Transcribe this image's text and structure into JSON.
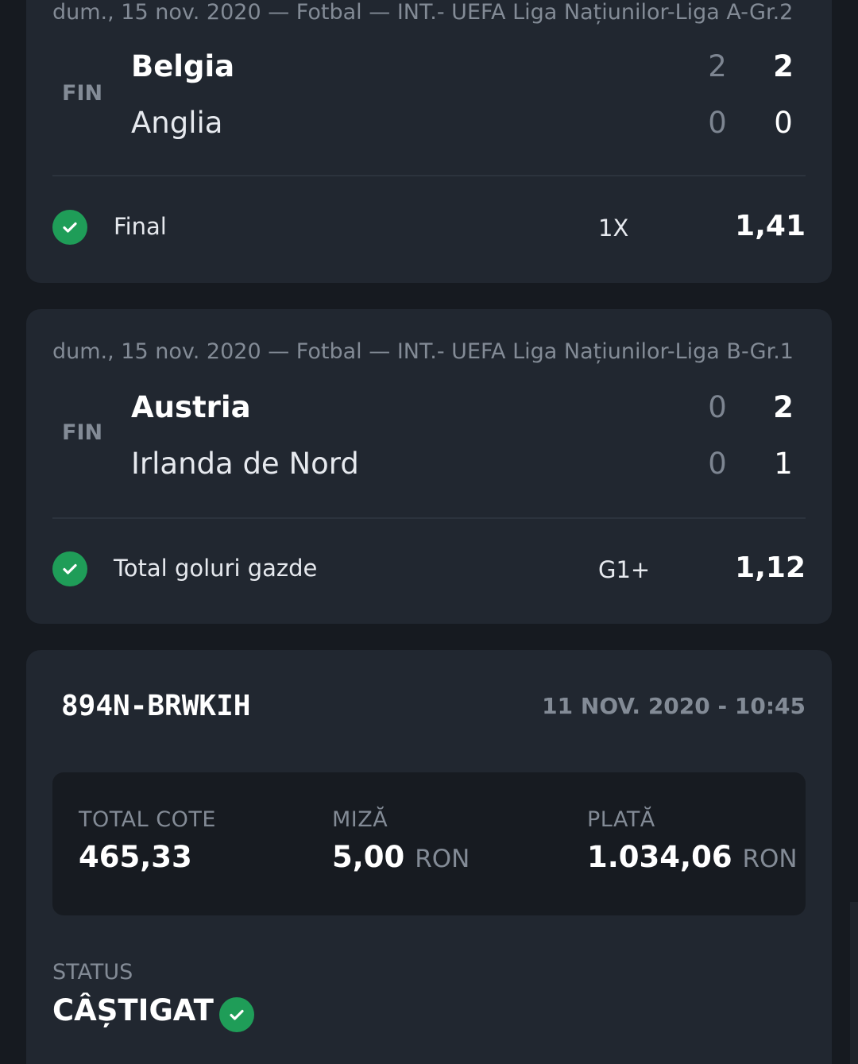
{
  "events": [
    {
      "meta": "dum., 15 nov. 2020 — Fotbal — INT.- UEFA Liga Națiunilor-Liga A-Gr.2",
      "status": "FIN",
      "home": {
        "name": "Belgia",
        "ht": "2",
        "ft": "2"
      },
      "away": {
        "name": "Anglia",
        "ht": "0",
        "ft": "0"
      },
      "bet": {
        "market": "Final",
        "pick": "1X",
        "odd": "1,41",
        "result_icon": "check-icon"
      }
    },
    {
      "meta": "dum., 15 nov. 2020 — Fotbal — INT.- UEFA Liga Națiunilor-Liga B-Gr.1",
      "status": "FIN",
      "home": {
        "name": "Austria",
        "ht": "0",
        "ft": "2"
      },
      "away": {
        "name": "Irlanda de Nord",
        "ht": "0",
        "ft": "1"
      },
      "bet": {
        "market": "Total goluri gazde",
        "pick": "G1+",
        "odd": "1,12",
        "result_icon": "check-icon"
      }
    }
  ],
  "ticket": {
    "code": "894N-BRWKIH",
    "date": "11 NOV. 2020 - 10:45",
    "total_odds": {
      "label": "TOTAL COTE",
      "value": "465,33"
    },
    "stake": {
      "label": "MIZĂ",
      "value": "5,00",
      "unit": "RON"
    },
    "payout": {
      "label": "PLATĂ",
      "value": "1.034,06",
      "unit": "RON"
    },
    "status_label": "STATUS",
    "status_value": "CÂȘTIGAT",
    "status_icon": "check-icon"
  },
  "colors": {
    "background": "#161a20",
    "card": "#212730",
    "success": "#1f9d58",
    "muted_text": "#838b96"
  }
}
